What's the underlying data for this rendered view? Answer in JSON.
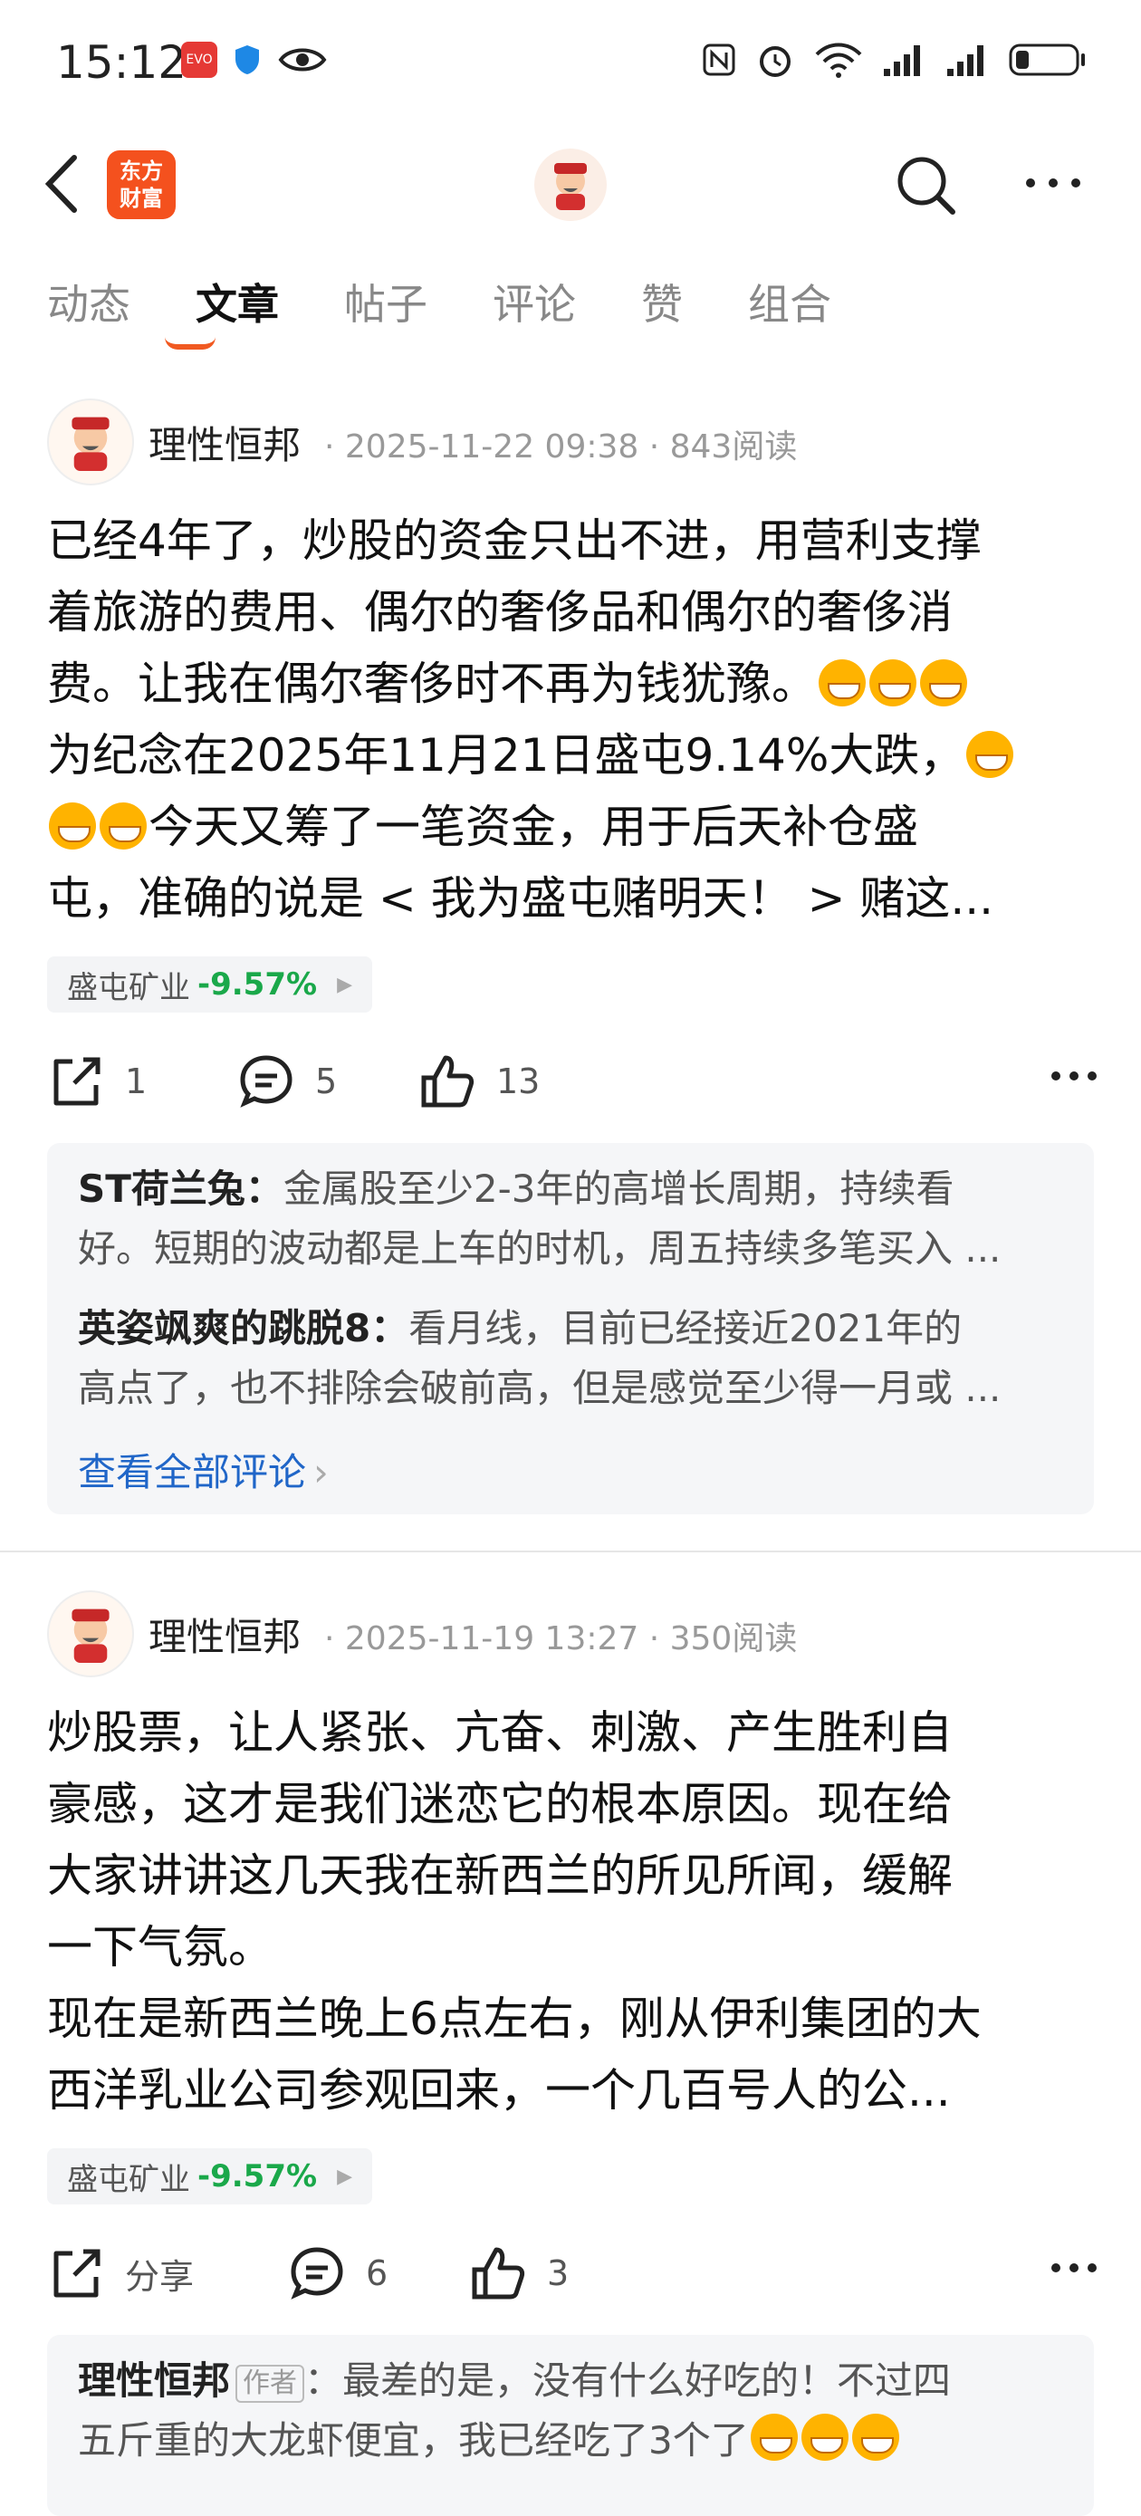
{
  "status_bar": {
    "time": "15:12",
    "app_badge": "EVO",
    "battery_level": 0.2
  },
  "nav": {
    "logo_text_line1": "东方",
    "logo_text_line2": "财富"
  },
  "tabs": [
    {
      "label": "动态",
      "active": false
    },
    {
      "label": "文章",
      "active": true
    },
    {
      "label": "帖子",
      "active": false
    },
    {
      "label": "评论",
      "active": false
    },
    {
      "label": "赞",
      "active": false
    },
    {
      "label": "组合",
      "active": false
    }
  ],
  "posts": [
    {
      "author": "理性恒邦",
      "meta": "· 2025-11-22 09:38 · 843阅读",
      "body_lines": [
        "已经4年了，炒股的资金只出不进，用营利支撑",
        "着旅游的费用、偶尔的奢侈品和偶尔的奢侈消",
        "费。让我在偶尔奢侈时不再为钱犹豫。",
        "为纪念在2025年11月21日盛屯9.14%大跌，",
        "今天又筹了一笔资金，用于后天补仓盛",
        "屯，准确的说是 < 我为盛屯赌明天！ > 赌这..."
      ],
      "stock": {
        "name": "盛屯矿业",
        "pct": "-9.57%"
      },
      "share_label": "1",
      "comment_count": "5",
      "like_count": "13",
      "comments": [
        {
          "name": "ST荷兰兔：",
          "text1": "金属股至少2-3年的高增长周期，持续看",
          "text2": "好。短期的波动都是上车的时机，周五持续多笔买入 ..."
        },
        {
          "name": "英姿飒爽的跳脱8：",
          "text1": "看月线，目前已经接近2021年的",
          "text2": "高点了，也不排除会破前高，但是感觉至少得一月或 ..."
        }
      ],
      "view_all": "查看全部评论"
    },
    {
      "author": "理性恒邦",
      "meta": "· 2025-11-19 13:27 · 350阅读",
      "body_lines": [
        "炒股票，让人紧张、亢奋、刺激、产生胜利自",
        "豪感，这才是我们迷恋它的根本原因。现在给",
        "大家讲讲这几天我在新西兰的所见所闻，缓解",
        "一下气氛。",
        "现在是新西兰晚上6点左右，刚从伊利集团的大",
        "西洋乳业公司参观回来，一个几百号人的公..."
      ],
      "stock": {
        "name": "盛屯矿业",
        "pct": "-9.57%"
      },
      "share_label": "分享",
      "comment_count": "6",
      "like_count": "3",
      "comments": [
        {
          "name": "理性恒邦",
          "tag": "作者",
          "text1": "：最差的是，没有什么好吃的！不过四",
          "text2": "五斤重的大龙虾便宜，我已经吃了3个了"
        }
      ]
    }
  ]
}
